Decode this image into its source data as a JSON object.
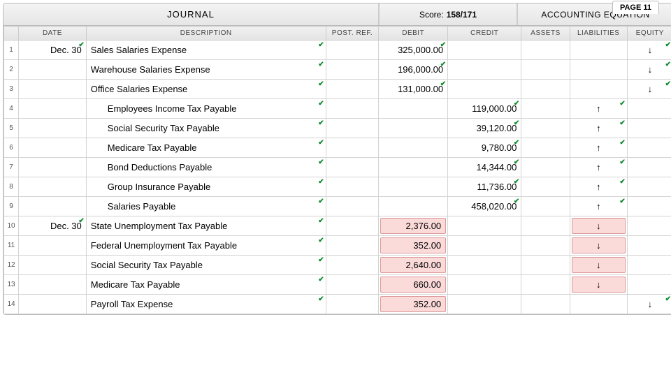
{
  "page_label": "PAGE 11",
  "header": {
    "journal": "JOURNAL",
    "score_label": "Score:",
    "score_value": "158/171",
    "equation": "ACCOUNTING EQUATION"
  },
  "columns": {
    "date": "DATE",
    "description": "DESCRIPTION",
    "postref": "POST. REF.",
    "debit": "DEBIT",
    "credit": "CREDIT",
    "assets": "ASSETS",
    "liabilities": "LIABILITIES",
    "equity": "EQUITY"
  },
  "rows": [
    {
      "n": "1",
      "date": "Dec. 30",
      "date_ok": true,
      "desc": "Sales Salaries Expense",
      "desc_ok": true,
      "indent": 0,
      "debit": "325,000.00",
      "debit_ok": true,
      "credit": "",
      "credit_ok": false,
      "assets": "",
      "assets_ok": false,
      "liab": "",
      "liab_ok": false,
      "equity": "↓",
      "equity_ok": true,
      "equity_wrong": false
    },
    {
      "n": "2",
      "date": "",
      "date_ok": false,
      "desc": "Warehouse Salaries Expense",
      "desc_ok": true,
      "indent": 0,
      "debit": "196,000.00",
      "debit_ok": true,
      "credit": "",
      "credit_ok": false,
      "assets": "",
      "assets_ok": false,
      "liab": "",
      "liab_ok": false,
      "equity": "↓",
      "equity_ok": true,
      "equity_wrong": false
    },
    {
      "n": "3",
      "date": "",
      "date_ok": false,
      "desc": "Office Salaries Expense",
      "desc_ok": true,
      "indent": 0,
      "debit": "131,000.00",
      "debit_ok": true,
      "credit": "",
      "credit_ok": false,
      "assets": "",
      "assets_ok": false,
      "liab": "",
      "liab_ok": false,
      "equity": "↓",
      "equity_ok": true,
      "equity_wrong": false
    },
    {
      "n": "4",
      "date": "",
      "date_ok": false,
      "desc": "Employees Income Tax Payable",
      "desc_ok": true,
      "indent": 1,
      "debit": "",
      "debit_ok": false,
      "credit": "119,000.00",
      "credit_ok": true,
      "assets": "",
      "assets_ok": false,
      "liab": "↑",
      "liab_ok": true,
      "equity": "",
      "equity_ok": false,
      "equity_wrong": false
    },
    {
      "n": "5",
      "date": "",
      "date_ok": false,
      "desc": "Social Security Tax Payable",
      "desc_ok": true,
      "indent": 1,
      "debit": "",
      "debit_ok": false,
      "credit": "39,120.00",
      "credit_ok": true,
      "assets": "",
      "assets_ok": false,
      "liab": "↑",
      "liab_ok": true,
      "equity": "",
      "equity_ok": false,
      "equity_wrong": false
    },
    {
      "n": "6",
      "date": "",
      "date_ok": false,
      "desc": "Medicare Tax Payable",
      "desc_ok": true,
      "indent": 1,
      "debit": "",
      "debit_ok": false,
      "credit": "9,780.00",
      "credit_ok": true,
      "assets": "",
      "assets_ok": false,
      "liab": "↑",
      "liab_ok": true,
      "equity": "",
      "equity_ok": false,
      "equity_wrong": false
    },
    {
      "n": "7",
      "date": "",
      "date_ok": false,
      "desc": "Bond Deductions Payable",
      "desc_ok": true,
      "indent": 1,
      "debit": "",
      "debit_ok": false,
      "credit": "14,344.00",
      "credit_ok": true,
      "assets": "",
      "assets_ok": false,
      "liab": "↑",
      "liab_ok": true,
      "equity": "",
      "equity_ok": false,
      "equity_wrong": false
    },
    {
      "n": "8",
      "date": "",
      "date_ok": false,
      "desc": "Group Insurance Payable",
      "desc_ok": true,
      "indent": 1,
      "debit": "",
      "debit_ok": false,
      "credit": "11,736.00",
      "credit_ok": true,
      "assets": "",
      "assets_ok": false,
      "liab": "↑",
      "liab_ok": true,
      "equity": "",
      "equity_ok": false,
      "equity_wrong": false
    },
    {
      "n": "9",
      "date": "",
      "date_ok": false,
      "desc": "Salaries Payable",
      "desc_ok": true,
      "indent": 1,
      "debit": "",
      "debit_ok": false,
      "credit": "458,020.00",
      "credit_ok": true,
      "assets": "",
      "assets_ok": false,
      "liab": "↑",
      "liab_ok": true,
      "equity": "",
      "equity_ok": false,
      "equity_wrong": false
    },
    {
      "n": "10",
      "date": "Dec. 30",
      "date_ok": true,
      "desc": "State Unemployment Tax Payable",
      "desc_ok": true,
      "indent": 0,
      "debit": "2,376.00",
      "debit_wrong": true,
      "credit": "",
      "credit_ok": false,
      "assets": "",
      "assets_ok": false,
      "liab": "↓",
      "liab_wrong": true,
      "equity": "",
      "equity_ok": false,
      "equity_wrong": false
    },
    {
      "n": "11",
      "date": "",
      "date_ok": false,
      "desc": "Federal Unemployment Tax Payable",
      "desc_ok": true,
      "indent": 0,
      "debit": "352.00",
      "debit_wrong": true,
      "credit": "",
      "credit_ok": false,
      "assets": "",
      "assets_ok": false,
      "liab": "↓",
      "liab_wrong": true,
      "equity": "",
      "equity_ok": false,
      "equity_wrong": false
    },
    {
      "n": "12",
      "date": "",
      "date_ok": false,
      "desc": "Social Security Tax Payable",
      "desc_ok": true,
      "indent": 0,
      "debit": "2,640.00",
      "debit_wrong": true,
      "credit": "",
      "credit_ok": false,
      "assets": "",
      "assets_ok": false,
      "liab": "↓",
      "liab_wrong": true,
      "equity": "",
      "equity_ok": false,
      "equity_wrong": false
    },
    {
      "n": "13",
      "date": "",
      "date_ok": false,
      "desc": "Medicare Tax Payable",
      "desc_ok": true,
      "indent": 0,
      "debit": "660.00",
      "debit_wrong": true,
      "credit": "",
      "credit_ok": false,
      "assets": "",
      "assets_ok": false,
      "liab": "↓",
      "liab_wrong": true,
      "equity": "",
      "equity_ok": false,
      "equity_wrong": false
    },
    {
      "n": "14",
      "date": "",
      "date_ok": false,
      "desc": "Payroll Tax Expense",
      "desc_ok": true,
      "indent": 0,
      "debit": "352.00",
      "debit_wrong": true,
      "credit": "",
      "credit_ok": false,
      "assets": "",
      "assets_ok": false,
      "liab": "",
      "liab_ok": false,
      "equity": "↓",
      "equity_ok": true,
      "equity_wrong": false
    }
  ]
}
